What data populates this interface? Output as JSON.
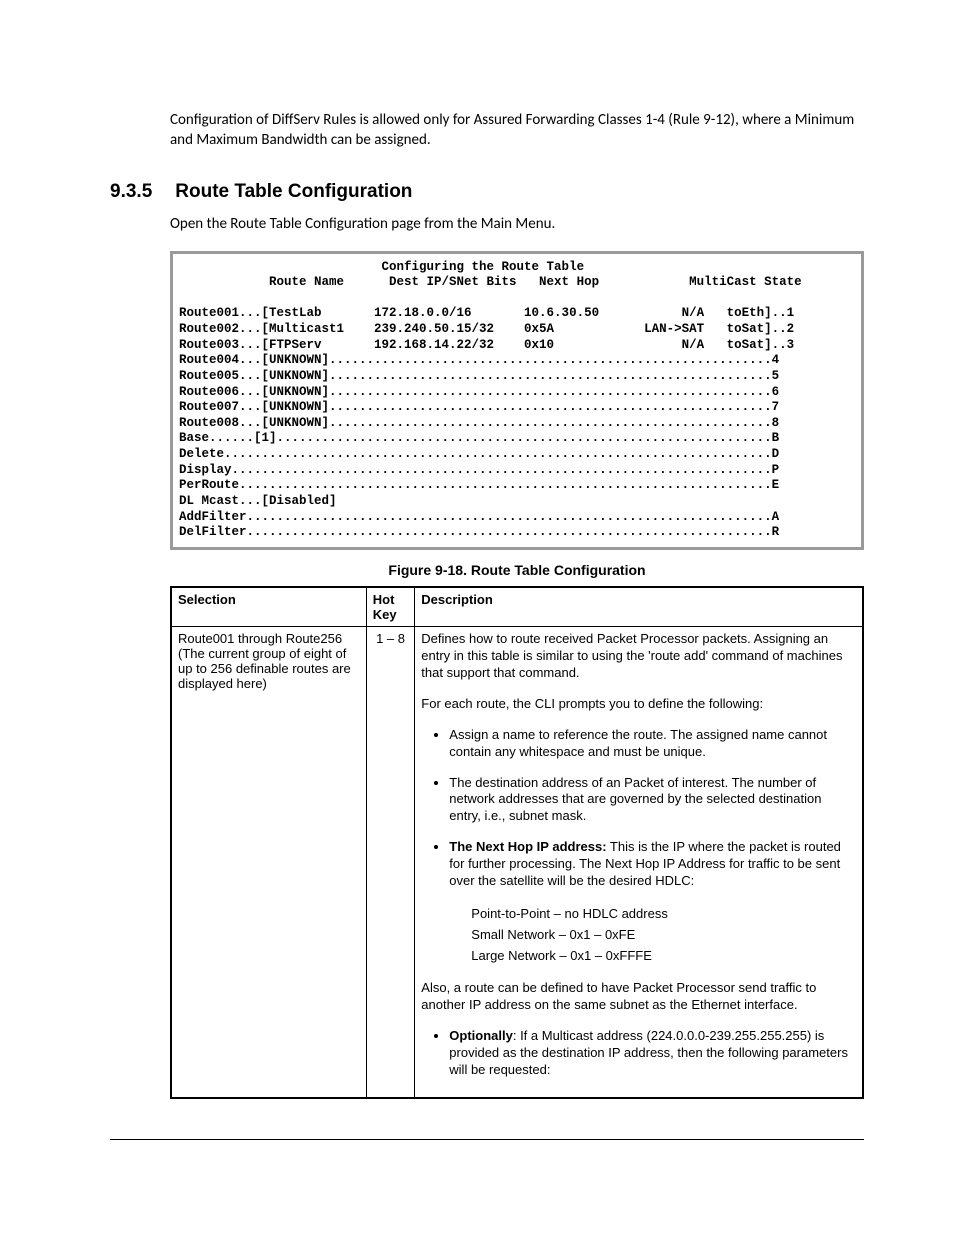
{
  "intro": "Configuration of DiffServ Rules is allowed only for Assured Forwarding Classes 1-4 (Rule 9-12), where a Minimum and Maximum Bandwidth can be assigned.",
  "section_number": "9.3.5",
  "section_title": "Route Table Configuration",
  "subintro": "Open the Route Table Configuration page from the Main Menu.",
  "console": {
    "title": "Configuring the Route Table",
    "headers": {
      "name": "Route Name",
      "dest": "Dest IP/SNet Bits",
      "next": "Next Hop",
      "multi": "MultiCast",
      "state": "State"
    },
    "routes": [
      {
        "label": "Route001...[TestLab",
        "dest": "172.18.0.0/16",
        "next": "10.6.30.50",
        "multi": "N/A",
        "state": "toEth]..1"
      },
      {
        "label": "Route002...[Multicast1",
        "dest": "239.240.50.15/32",
        "next": "0x5A",
        "multi": "LAN->SAT",
        "state": "toSat]..2"
      },
      {
        "label": "Route003...[FTPServ",
        "dest": "192.168.14.22/32",
        "next": "0x10",
        "multi": "N/A",
        "state": "toSat]..3"
      }
    ],
    "dotted": [
      {
        "left": "Route004...[UNKNOWN]",
        "right": "4"
      },
      {
        "left": "Route005...[UNKNOWN]",
        "right": "5"
      },
      {
        "left": "Route006...[UNKNOWN]",
        "right": "6"
      },
      {
        "left": "Route007...[UNKNOWN]",
        "right": "7"
      },
      {
        "left": "Route008...[UNKNOWN]",
        "right": "8"
      },
      {
        "left": "Base......[1]",
        "right": "B"
      },
      {
        "left": "Delete",
        "right": "D"
      },
      {
        "left": "Display",
        "right": "P"
      },
      {
        "left": "PerRoute",
        "right": "E"
      }
    ],
    "nolinekey": "DL Mcast...[Disabled]",
    "dotted2": [
      {
        "left": "AddFilter",
        "right": "A"
      },
      {
        "left": "DelFilter",
        "right": "R"
      }
    ]
  },
  "figure_caption": "Figure 9-18. Route Table Configuration",
  "table": {
    "headers": {
      "sel": "Selection",
      "hot": "Hot Key",
      "desc": "Description"
    },
    "row": {
      "selection_l1": "Route001 through Route256",
      "selection_l2": "(The current group of eight of up to 256 definable routes are displayed here)",
      "hotkey": "1 – 8",
      "p1": "Defines how to route received Packet Processor packets. Assigning an entry in this table is similar to using the 'route add' command of machines that support that command.",
      "p2": "For each route, the CLI prompts you to define the following:",
      "b1": "Assign a name  to reference the route. The assigned name cannot contain any whitespace and must be unique.",
      "b2": "The destination address of an Packet of interest. The number of network addresses that are governed by the selected destination entry, i.e., subnet mask.",
      "b3_bold": "The Next Hop IP address:",
      "b3_rest": " This is the IP where the packet is routed for further processing. The Next Hop IP Address for traffic to be sent over the satellite will be the desired HDLC:",
      "sub1": "Point-to-Point – no HDLC address",
      "sub2": "Small Network – 0x1 – 0xFE",
      "sub3": "Large Network – 0x1 – 0xFFFE",
      "p3": "Also, a route can be defined to have Packet Processor send traffic to another IP address on the same subnet as the Ethernet interface.",
      "b4_bold": "Optionally",
      "b4_rest": ": If a Multicast address (224.0.0.0-239.255.255.255) is provided as the destination IP address, then the following parameters will be requested:"
    }
  }
}
